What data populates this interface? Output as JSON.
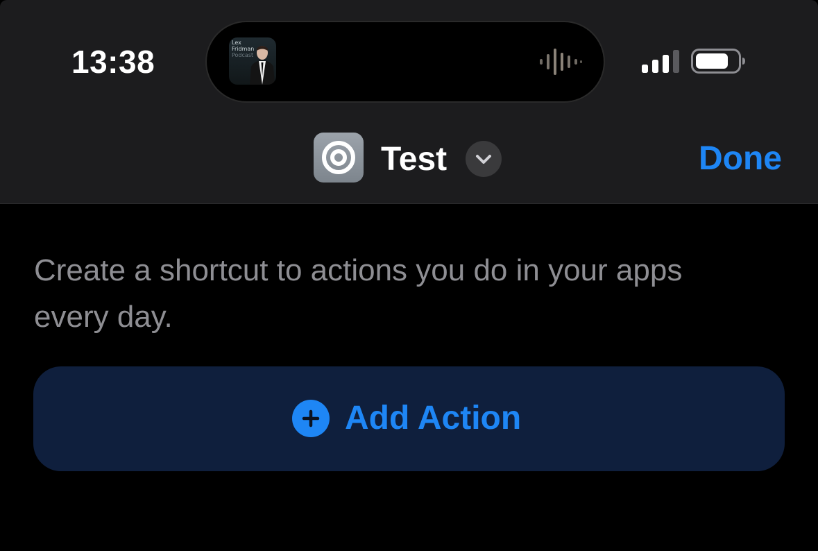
{
  "status_bar": {
    "time": "13:38",
    "now_playing": {
      "artwork_lines": [
        "Lex",
        "Fridman",
        "Podcast"
      ],
      "artwork_icon": "podcast-artwork",
      "activity_icon": "audio-waveform-icon"
    },
    "signal_icon": "cellular-signal-icon",
    "battery_icon": "battery-icon"
  },
  "nav": {
    "app_icon": "shortcut-target-icon",
    "title": "Test",
    "menu_icon": "chevron-down-icon",
    "done_label": "Done"
  },
  "content": {
    "description": "Create a shortcut to actions you do in your apps every day.",
    "add_action": {
      "icon": "plus-circle-icon",
      "label": "Add Action"
    }
  },
  "colors": {
    "accent": "#1e86f5",
    "header_bg": "#1c1c1e",
    "page_bg": "#000000",
    "secondary_text": "#8e8e93",
    "button_bg": "#0f1f3d"
  }
}
